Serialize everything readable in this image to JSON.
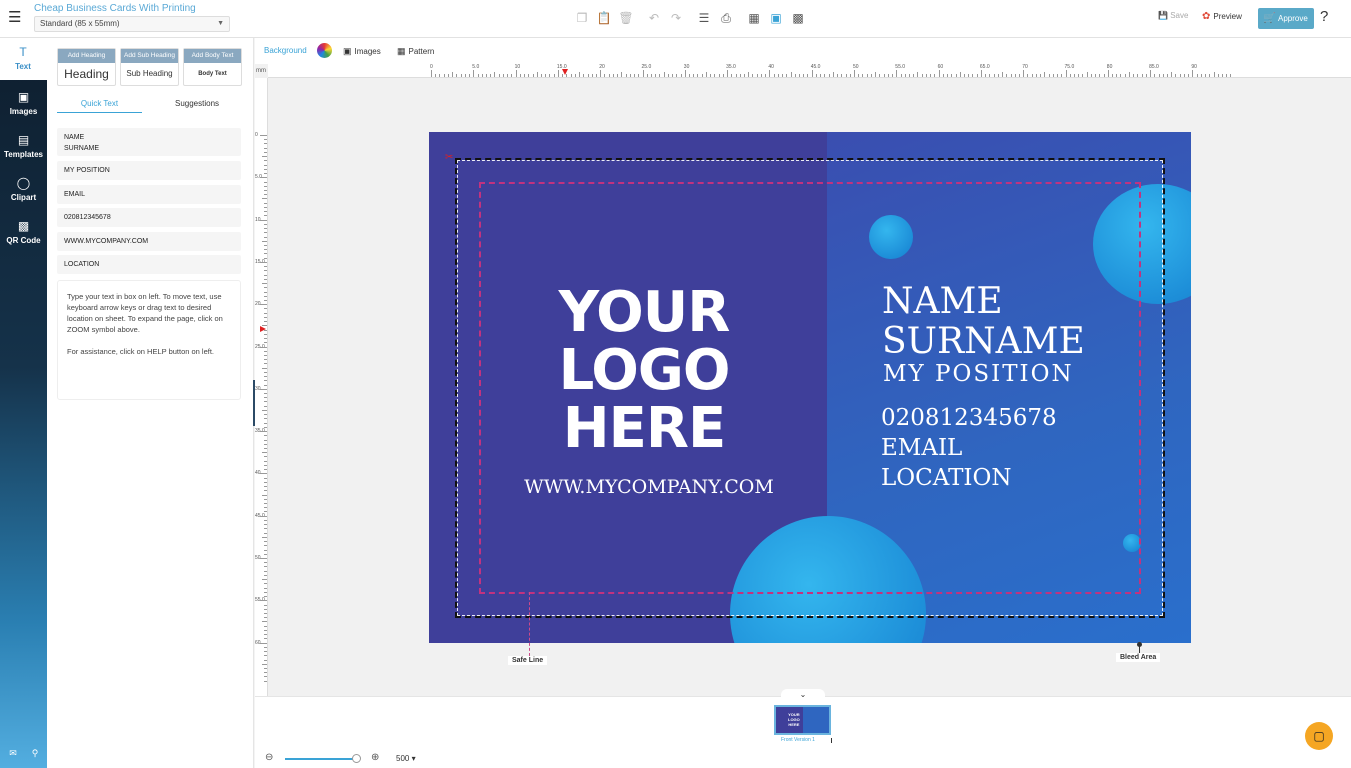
{
  "header": {
    "title": "Cheap Business Cards With Printing",
    "size_option": "Standard (85 x 55mm)",
    "save_label": "Save",
    "preview_label": "Preview",
    "approve_label": "Approve",
    "help_label": "?"
  },
  "rail": {
    "items": [
      {
        "label": "Text",
        "icon": "text-icon"
      },
      {
        "label": "Images",
        "icon": "image-icon"
      },
      {
        "label": "Templates",
        "icon": "templates-icon"
      },
      {
        "label": "Clipart",
        "icon": "clipart-icon"
      },
      {
        "label": "QR Code",
        "icon": "qr-code-icon"
      }
    ]
  },
  "panel": {
    "add_heading": {
      "header": "Add Heading",
      "sample": "Heading"
    },
    "add_sub_heading": {
      "header": "Add Sub Heading",
      "sample": "Sub Heading"
    },
    "add_body_text": {
      "header": "Add Body Text",
      "sample": "Body Text"
    },
    "tabs": {
      "quick_text": "Quick Text",
      "suggestions": "Suggestions"
    },
    "fields": {
      "name_line1": "NAME",
      "name_line2": "SURNAME",
      "position": "MY POSITION",
      "email": "EMAIL",
      "phone": "020812345678",
      "website": "WWW.MYCOMPANY.COM",
      "location": "LOCATION"
    },
    "help_text_1": "Type your text in box on left. To move text, use keyboard arrow keys or drag text to desired location on sheet. To expand the page, click on ZOOM symbol above.",
    "help_text_2": "For assistance, click on HELP button on left."
  },
  "subbar": {
    "background_label": "Background",
    "images_label": "Images",
    "pattern_label": "Pattern"
  },
  "ruler": {
    "unit": "mm",
    "top_labels": [
      "0",
      "5.0",
      "10",
      "15.0",
      "20",
      "25.0",
      "30",
      "35.0",
      "40",
      "45.0",
      "50",
      "55.0",
      "60",
      "65.0",
      "70",
      "75.0",
      "80",
      "85.0",
      "90"
    ],
    "left_labels": [
      "0",
      "5.0",
      "10",
      "15.0",
      "20",
      "25.0",
      "30",
      "35.0",
      "40",
      "45.0",
      "50",
      "55.0",
      "60"
    ]
  },
  "card": {
    "logo_line1": "YOUR",
    "logo_line2": "LOGO",
    "logo_line3": "HERE",
    "website": "WWW.MYCOMPANY.COM",
    "name": "NAME",
    "surname": "SURNAME",
    "position": "MY POSITION",
    "phone": "020812345678",
    "email": "EMAIL",
    "location": "LOCATION",
    "colors": {
      "left": "#3f3f9a",
      "right": "#2f66c0",
      "bubbles": "#1d8ed8",
      "safe_line": "#c2327f"
    }
  },
  "callouts": {
    "safe_line": "Safe Line",
    "bleed_area": "Bleed Area"
  },
  "strip": {
    "thumb_label": "Front Version 1"
  },
  "zoom": {
    "value": "500"
  }
}
